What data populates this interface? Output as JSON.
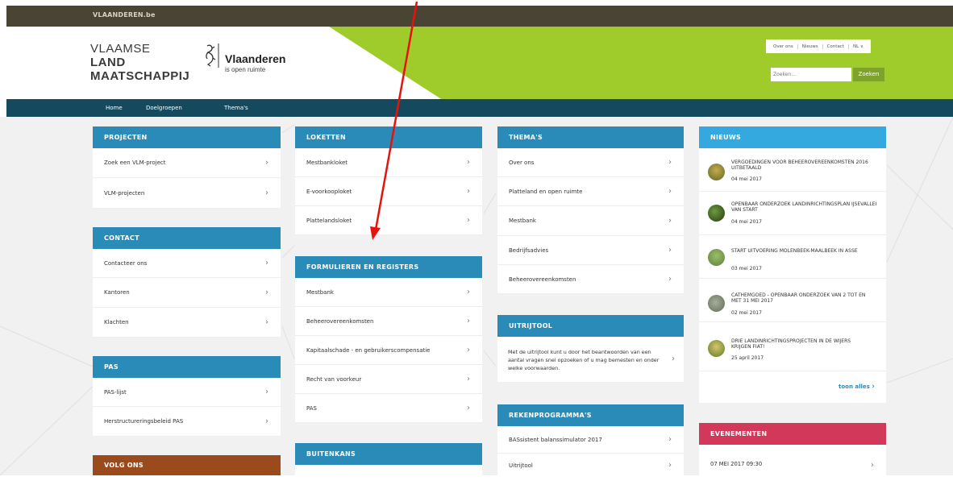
{
  "topbar": {
    "site": "VLAANDEREN.be"
  },
  "header": {
    "org_line1": "VLAAMSE",
    "org_line2": "LAND",
    "org_line3": "MAATSCHAPPIJ",
    "brand_name": "Vlaanderen",
    "brand_tagline": "is open ruimte",
    "topnav": [
      "Over ons",
      "Nieuws",
      "Contact",
      "NL ∨"
    ],
    "search_placeholder": "Zoeken...",
    "search_button": "Zoeken"
  },
  "mainnav": [
    "Home",
    "Doelgroepen",
    "Thema's"
  ],
  "colors": {
    "header_green": "#9fcb2b",
    "nav_dark": "#154a5e",
    "panel_blue": "#2a8bb8",
    "news_blue": "#33a9e0",
    "events_red": "#d1385a",
    "follow_brown": "#9b4a1b",
    "annotation_arrow": "#e8120c"
  },
  "projecten": {
    "title": "PROJECTEN",
    "items": [
      "Zoek een VLM-project",
      "VLM-projecten"
    ]
  },
  "contact": {
    "title": "CONTACT",
    "items": [
      "Contacteer ons",
      "Kantoren",
      "Klachten"
    ]
  },
  "pas": {
    "title": "PAS",
    "items": [
      "PAS-lijst",
      "Herstructureringsbeleid PAS"
    ]
  },
  "volgons": {
    "title": "VOLG ONS"
  },
  "loketten": {
    "title": "LOKETTEN",
    "items": [
      "Mestbankloket",
      "E-voorkooploket",
      "Plattelandsloket"
    ]
  },
  "formulieren": {
    "title": "FORMULIEREN EN REGISTERS",
    "items": [
      "Mestbank",
      "Beheerovereenkomsten",
      "Kapitaalschade - en gebruikerscompensatie",
      "Recht van voorkeur",
      "PAS"
    ]
  },
  "buitenkans": {
    "title": "BUITENKANS"
  },
  "themas": {
    "title": "THEMA'S",
    "items": [
      "Over ons",
      "Platteland en open ruimte",
      "Mestbank",
      "Bedrijfsadvies",
      "Beheerovereenkomsten"
    ]
  },
  "uitrijtool": {
    "title": "UITRIJTOOL",
    "text": "Met de uitrijtool kunt u door het beantwoorden van een aantal vragen snel opzoeken of u mag bemesten en onder welke voorwaarden."
  },
  "rekenprogrammas": {
    "title": "REKENPROGRAMMA'S",
    "items": [
      "BASsistent balanssimulator 2017",
      "Uitrijtool"
    ]
  },
  "nieuws": {
    "title": "NIEUWS",
    "items": [
      {
        "title": "VERGOEDINGEN VOOR BEHEEROVEREENKOMSTEN 2016 UITBETAALD",
        "date": "04 mei 2017"
      },
      {
        "title": "OPENBAAR ONDERZOEK LANDINRICHTINGSPLAN IJSEVALLEI VAN START",
        "date": "04 mei 2017"
      },
      {
        "title": "START UITVOERING MOLENBEEK-MAALBEEK IN ASSE",
        "date": "03 mei 2017"
      },
      {
        "title": "CATHEMGOED - OPENBAAR ONDERZOEK VAN 2 TOT EN MET 31 MEI 2017",
        "date": "02 mei 2017"
      },
      {
        "title": "DRIE LANDINRICHTINGSPROJECTEN IN DE WIJERS KRIJGEN FIAT!",
        "date": "25 april 2017"
      }
    ],
    "more": "toon alles"
  },
  "evenementen": {
    "title": "EVENEMENTEN",
    "items": [
      {
        "date": "07 MEI 2017 09:30"
      }
    ]
  }
}
